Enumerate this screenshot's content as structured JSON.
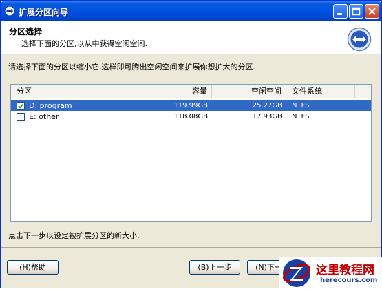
{
  "window": {
    "title": "扩展分区向导"
  },
  "header": {
    "title": "分区选择",
    "subtitle": "选择下面的分区,以从中获得空闲空间."
  },
  "instruction": "请选择下面的分区以缩小它,这样即可腾出空闲空间来扩展你想扩大的分区.",
  "table": {
    "columns": [
      "分区",
      "容量",
      "空闲空间",
      "文件系统"
    ],
    "rows": [
      {
        "name": "D: program",
        "capacity": "119.99GB",
        "free": "25.27GB",
        "fs": "NTFS",
        "checked": true,
        "selected": true
      },
      {
        "name": "E: other",
        "capacity": "118.08GB",
        "free": "17.93GB",
        "fs": "NTFS",
        "checked": false,
        "selected": false
      }
    ]
  },
  "footer_note": "点击下一步以设定被扩展分区的新大小.",
  "buttons": {
    "help": "(H)帮助",
    "back": "(B)上一步",
    "next": "(N)下一步"
  },
  "watermark": {
    "title": "这里教程网",
    "url": "herecours.com"
  },
  "colors": {
    "titlebar": "#0052e0",
    "selection": "#316ac5",
    "dialog_bg": "#ece9d8",
    "watermark_red": "#c00000"
  },
  "icons": {
    "title": "wizard-app-icon",
    "header": "expand-arrows-icon"
  }
}
